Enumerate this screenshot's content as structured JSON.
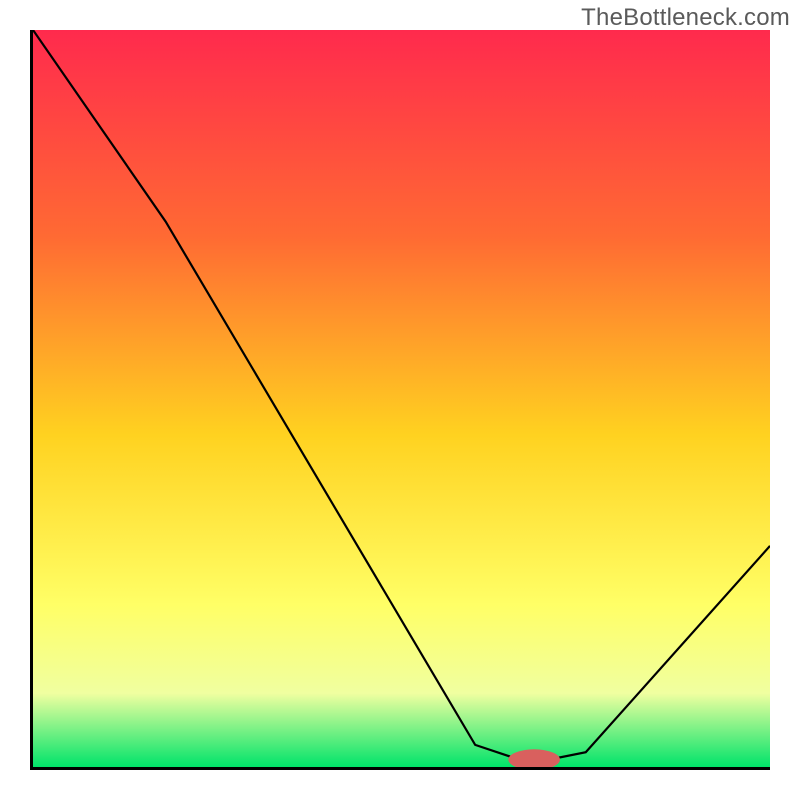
{
  "watermark": "TheBottleneck.com",
  "colors": {
    "gradient_top": "#ff2a4d",
    "gradient_mid_upper": "#ff6a33",
    "gradient_mid": "#ffd220",
    "gradient_mid_lower": "#ffff66",
    "gradient_lower": "#f0ffa0",
    "gradient_bottom": "#00e36a",
    "curve": "#000000",
    "marker": "#d9605e"
  },
  "chart_data": {
    "type": "line",
    "title": "",
    "xlabel": "",
    "ylabel": "",
    "xlim": [
      0,
      100
    ],
    "ylim": [
      0,
      100
    ],
    "series": [
      {
        "name": "bottleneck-curve",
        "x": [
          0,
          18,
          60,
          66,
          70,
          75,
          100
        ],
        "values": [
          100,
          74,
          3,
          1,
          1,
          2,
          30
        ]
      }
    ],
    "marker": {
      "name": "optimal-point",
      "x": 68,
      "y": 1,
      "rx": 3.5,
      "ry": 1.4
    },
    "gradient_stops": [
      {
        "offset": 0,
        "color": "#ff2a4d"
      },
      {
        "offset": 0.28,
        "color": "#ff6a33"
      },
      {
        "offset": 0.55,
        "color": "#ffd220"
      },
      {
        "offset": 0.78,
        "color": "#ffff66"
      },
      {
        "offset": 0.9,
        "color": "#f0ffa0"
      },
      {
        "offset": 1.0,
        "color": "#00e36a"
      }
    ]
  }
}
